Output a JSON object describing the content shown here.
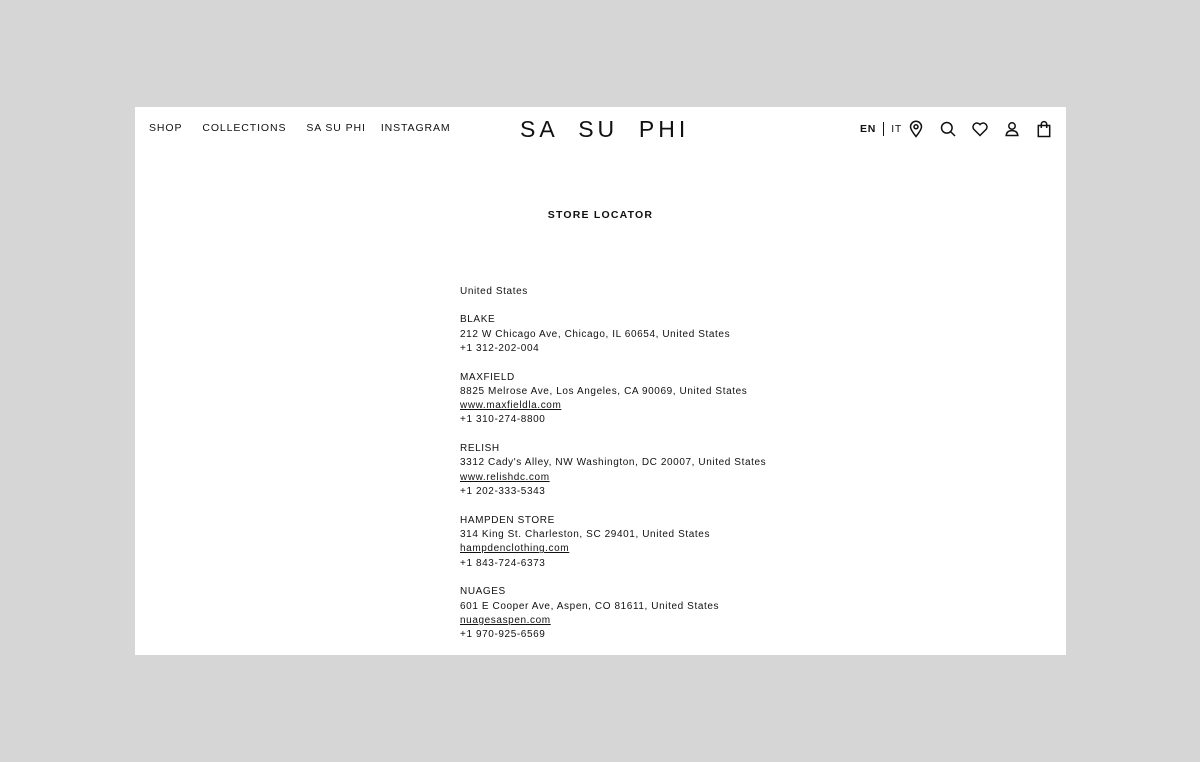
{
  "nav": {
    "shop": "SHOP",
    "collections": "COLLECTIONS",
    "sasuphi": "SA SU PHI",
    "instagram": "INSTAGRAM"
  },
  "logo": "SA  SU  PHI",
  "lang": {
    "en": "EN",
    "it": "IT"
  },
  "icons": [
    "location-pin-icon",
    "search-icon",
    "heart-icon",
    "user-icon",
    "shopping-bag-icon"
  ],
  "page_title": "STORE LOCATOR",
  "country": "United States",
  "stores": [
    {
      "name": "BLAKE",
      "address": "212 W Chicago Ave, Chicago, IL 60654, United States",
      "phone": "+1 312-202-004"
    },
    {
      "name": "MAXFIELD",
      "address": "8825 Melrose Ave, Los Angeles, CA 90069, United States",
      "website": "www.maxfieldla.com",
      "phone": "+1 310-274-8800"
    },
    {
      "name": "RELISH",
      "address": "3312 Cady's Alley, NW Washington, DC 20007, United States",
      "website": "www.relishdc.com",
      "phone": "+1 202-333-5343"
    },
    {
      "name": "HAMPDEN STORE",
      "address": "314 King St. Charleston, SC 29401, United States",
      "website": "hampdenclothing.com",
      "phone": "+1 843-724-6373"
    },
    {
      "name": "NUAGES",
      "address": "601 E Cooper Ave, Aspen, CO 81611, United States",
      "website": "nuagesaspen.com",
      "phone": "+1 970-925-6569"
    }
  ]
}
